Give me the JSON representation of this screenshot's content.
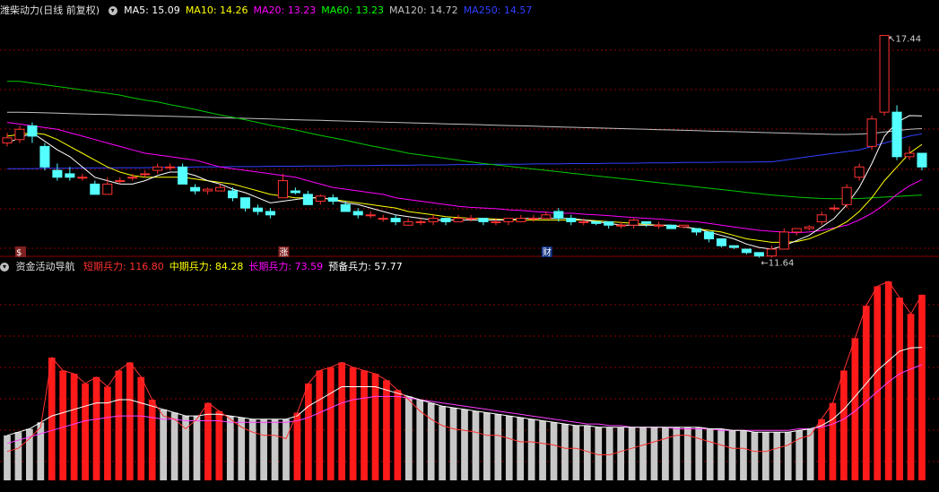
{
  "main_panel": {
    "title": "潍柴动力(日线 前复权)",
    "toggle_icon": "chevron-down-icon",
    "ma": [
      {
        "label": "MA5: 15.09",
        "color": "#ffffff"
      },
      {
        "label": "MA10: 14.26",
        "color": "#ffff00"
      },
      {
        "label": "MA20: 13.23",
        "color": "#ff00ff"
      },
      {
        "label": "MA60: 13.23",
        "color": "#00ff00"
      },
      {
        "label": "MA120: 14.72",
        "color": "#c0c0c0"
      },
      {
        "label": "MA250: 14.57",
        "color": "#3040ff"
      }
    ],
    "high_label": "17.44",
    "low_label": "11.64",
    "markers": [
      {
        "text": "$",
        "index": 1
      },
      {
        "text": "涨",
        "index": 22
      },
      {
        "text": "财",
        "index": 43
      }
    ]
  },
  "indicator_panel": {
    "title": "资金活动导航",
    "toggle_icon": "chevron-down-icon",
    "values": [
      {
        "label": "短期兵力: 116.80",
        "color": "#ff3030"
      },
      {
        "label": "中期兵力: 84.28",
        "color": "#ffff00"
      },
      {
        "label": "长期兵力: 73.59",
        "color": "#ff00ff"
      },
      {
        "label": "预备兵力: 57.77",
        "color": "#ffffff"
      }
    ]
  },
  "colors": {
    "up": "#ff3232",
    "down": "#54ffff",
    "grid": "#8b0000",
    "ma120": "#c0c0c0",
    "ma250": "#3040ff",
    "ma60": "#00c800",
    "bar_red": "#ff1a1a",
    "bar_gray": "#c8c8c8"
  },
  "chart_data": [
    {
      "type": "candlestick",
      "price_range": [
        11.2,
        17.9
      ],
      "candles": [
        [
          14.3,
          14.45,
          14.6,
          14.2
        ],
        [
          14.4,
          14.7,
          14.8,
          14.3
        ],
        [
          14.8,
          14.5,
          14.9,
          14.3
        ],
        [
          14.2,
          13.6,
          14.3,
          13.5
        ],
        [
          13.5,
          13.3,
          13.7,
          13.2
        ],
        [
          13.4,
          13.3,
          13.6,
          13.2
        ],
        [
          13.3,
          13.3,
          13.4,
          13.2
        ],
        [
          13.1,
          12.8,
          13.2,
          12.8
        ],
        [
          12.8,
          13.1,
          13.3,
          12.8
        ],
        [
          13.2,
          13.2,
          13.3,
          13.1
        ],
        [
          13.3,
          13.3,
          13.4,
          13.2
        ],
        [
          13.4,
          13.4,
          13.5,
          13.3
        ],
        [
          13.5,
          13.6,
          13.7,
          13.4
        ],
        [
          13.6,
          13.6,
          13.7,
          13.5
        ],
        [
          13.6,
          13.1,
          13.7,
          13.1
        ],
        [
          13.0,
          12.9,
          13.1,
          12.8
        ],
        [
          12.9,
          12.95,
          13.0,
          12.8
        ],
        [
          12.9,
          13.0,
          13.1,
          12.9
        ],
        [
          12.9,
          12.7,
          13.0,
          12.6
        ],
        [
          12.7,
          12.4,
          12.7,
          12.3
        ],
        [
          12.4,
          12.3,
          12.5,
          12.2
        ],
        [
          12.3,
          12.2,
          12.4,
          12.1
        ],
        [
          12.7,
          13.2,
          13.4,
          12.7
        ],
        [
          12.9,
          12.85,
          13.0,
          12.8
        ],
        [
          12.8,
          12.5,
          12.9,
          12.5
        ],
        [
          12.6,
          12.75,
          12.8,
          12.5
        ],
        [
          12.7,
          12.6,
          12.8,
          12.5
        ],
        [
          12.5,
          12.3,
          12.6,
          12.3
        ],
        [
          12.3,
          12.2,
          12.4,
          12.1
        ],
        [
          12.2,
          12.2,
          12.3,
          12.1
        ],
        [
          12.1,
          12.1,
          12.2,
          12.0
        ],
        [
          12.1,
          12.0,
          12.2,
          11.9
        ],
        [
          11.9,
          12.0,
          12.1,
          11.9
        ],
        [
          12.0,
          12.0,
          12.1,
          11.9
        ],
        [
          12.0,
          12.1,
          12.2,
          11.9
        ],
        [
          12.1,
          12.0,
          12.1,
          11.9
        ],
        [
          12.0,
          12.1,
          12.2,
          12.0
        ],
        [
          12.1,
          12.1,
          12.2,
          12.0
        ],
        [
          12.1,
          12.0,
          12.1,
          11.9
        ],
        [
          12.0,
          12.0,
          12.1,
          11.9
        ],
        [
          12.0,
          12.1,
          12.1,
          11.9
        ],
        [
          12.0,
          12.1,
          12.2,
          12.0
        ],
        [
          12.1,
          12.1,
          12.2,
          12.0
        ],
        [
          12.1,
          12.2,
          12.3,
          12.1
        ],
        [
          12.3,
          12.1,
          12.4,
          12.0
        ],
        [
          12.1,
          12.0,
          12.2,
          11.9
        ],
        [
          12.0,
          12.0,
          12.1,
          11.9
        ],
        [
          12.0,
          11.95,
          12.0,
          11.9
        ],
        [
          12.0,
          11.9,
          12.0,
          11.8
        ],
        [
          11.9,
          11.9,
          12.0,
          11.8
        ],
        [
          11.9,
          12.05,
          12.1,
          11.8
        ],
        [
          12.0,
          11.95,
          12.0,
          11.85
        ],
        [
          11.9,
          11.9,
          12.0,
          11.8
        ],
        [
          11.9,
          11.8,
          11.9,
          11.8
        ],
        [
          11.85,
          11.9,
          11.9,
          11.8
        ],
        [
          11.8,
          11.7,
          11.8,
          11.6
        ],
        [
          11.7,
          11.5,
          11.7,
          11.4
        ],
        [
          11.5,
          11.3,
          11.5,
          11.25
        ],
        [
          11.3,
          11.25,
          11.3,
          11.2
        ],
        [
          11.2,
          11.1,
          11.2,
          11.05
        ],
        [
          11.1,
          11.0,
          11.1,
          10.95
        ],
        [
          11.0,
          11.2,
          11.3,
          10.95
        ],
        [
          11.2,
          11.7,
          11.8,
          11.2
        ],
        [
          11.7,
          11.8,
          11.8,
          11.6
        ],
        [
          11.8,
          11.85,
          11.9,
          11.75
        ],
        [
          12.0,
          12.2,
          12.3,
          11.9
        ],
        [
          12.4,
          12.4,
          12.5,
          12.3
        ],
        [
          12.5,
          13.0,
          13.1,
          12.4
        ],
        [
          13.3,
          13.6,
          13.7,
          13.2
        ],
        [
          14.2,
          15.0,
          15.1,
          14.1
        ],
        [
          15.2,
          17.44,
          17.44,
          15.1
        ],
        [
          15.2,
          13.9,
          15.4,
          13.8
        ],
        [
          13.9,
          14.0,
          14.2,
          13.8
        ],
        [
          14.0,
          13.6,
          14.0,
          13.5
        ]
      ],
      "ma5": [
        14.3,
        14.45,
        14.6,
        14.35,
        14.1,
        13.9,
        13.6,
        13.3,
        13.2,
        13.1,
        13.1,
        13.2,
        13.35,
        13.45,
        13.45,
        13.35,
        13.2,
        13.1,
        12.95,
        12.85,
        12.7,
        12.55,
        12.6,
        12.65,
        12.7,
        12.7,
        12.65,
        12.55,
        12.5,
        12.4,
        12.3,
        12.2,
        12.15,
        12.1,
        12.05,
        12.05,
        12.05,
        12.05,
        12.05,
        12.05,
        12.05,
        12.1,
        12.1,
        12.1,
        12.1,
        12.1,
        12.05,
        12.0,
        11.95,
        11.9,
        11.9,
        11.9,
        11.9,
        11.9,
        11.85,
        11.8,
        11.7,
        11.6,
        11.5,
        11.35,
        11.25,
        11.2,
        11.3,
        11.45,
        11.6,
        11.85,
        12.1,
        12.5,
        13.0,
        13.7,
        14.5,
        14.9,
        15.1,
        15.09
      ],
      "ma10": [
        14.5,
        14.55,
        14.6,
        14.55,
        14.4,
        14.2,
        14.0,
        13.8,
        13.6,
        13.45,
        13.35,
        13.3,
        13.3,
        13.3,
        13.3,
        13.25,
        13.2,
        13.15,
        13.1,
        13.0,
        12.9,
        12.8,
        12.75,
        12.7,
        12.7,
        12.7,
        12.65,
        12.6,
        12.55,
        12.5,
        12.45,
        12.4,
        12.3,
        12.25,
        12.2,
        12.15,
        12.12,
        12.1,
        12.1,
        12.08,
        12.05,
        12.05,
        12.05,
        12.05,
        12.05,
        12.05,
        12.05,
        12.03,
        12.0,
        11.98,
        11.95,
        11.92,
        11.9,
        11.88,
        11.85,
        11.8,
        11.75,
        11.7,
        11.6,
        11.5,
        11.45,
        11.4,
        11.4,
        11.42,
        11.5,
        11.65,
        11.8,
        12.0,
        12.3,
        12.7,
        13.2,
        13.6,
        14.0,
        14.26
      ],
      "ma20": [
        14.9,
        14.85,
        14.8,
        14.75,
        14.7,
        14.6,
        14.5,
        14.4,
        14.3,
        14.2,
        14.1,
        14.0,
        13.95,
        13.9,
        13.85,
        13.8,
        13.7,
        13.6,
        13.55,
        13.5,
        13.45,
        13.4,
        13.35,
        13.3,
        13.2,
        13.1,
        13.0,
        12.95,
        12.9,
        12.85,
        12.8,
        12.7,
        12.65,
        12.6,
        12.55,
        12.5,
        12.45,
        12.42,
        12.4,
        12.38,
        12.35,
        12.33,
        12.3,
        12.28,
        12.25,
        12.25,
        12.22,
        12.2,
        12.18,
        12.15,
        12.12,
        12.1,
        12.08,
        12.05,
        12.02,
        12.0,
        11.95,
        11.9,
        11.85,
        11.8,
        11.75,
        11.72,
        11.7,
        11.68,
        11.7,
        11.75,
        11.82,
        11.9,
        12.05,
        12.25,
        12.5,
        12.8,
        13.05,
        13.23
      ],
      "ma60": [
        16.1,
        16.1,
        16.05,
        16.0,
        15.95,
        15.9,
        15.85,
        15.8,
        15.75,
        15.7,
        15.62,
        15.55,
        15.5,
        15.42,
        15.35,
        15.28,
        15.2,
        15.12,
        15.05,
        14.98,
        14.9,
        14.82,
        14.75,
        14.68,
        14.6,
        14.52,
        14.45,
        14.38,
        14.3,
        14.22,
        14.15,
        14.08,
        14.0,
        13.95,
        13.9,
        13.85,
        13.8,
        13.75,
        13.7,
        13.66,
        13.62,
        13.58,
        13.54,
        13.5,
        13.46,
        13.42,
        13.38,
        13.34,
        13.3,
        13.26,
        13.22,
        13.18,
        13.14,
        13.1,
        13.06,
        13.02,
        12.98,
        12.94,
        12.9,
        12.86,
        12.82,
        12.78,
        12.75,
        12.72,
        12.7,
        12.68,
        12.67,
        12.67,
        12.68,
        12.7,
        12.72,
        12.74,
        12.76,
        12.78
      ],
      "ma120": [
        15.2,
        15.2,
        15.19,
        15.18,
        15.17,
        15.16,
        15.15,
        15.14,
        15.13,
        15.12,
        15.11,
        15.1,
        15.09,
        15.08,
        15.07,
        15.06,
        15.05,
        15.04,
        15.03,
        15.02,
        15.01,
        15.0,
        14.99,
        14.98,
        14.97,
        14.96,
        14.95,
        14.94,
        14.93,
        14.92,
        14.91,
        14.9,
        14.89,
        14.88,
        14.87,
        14.86,
        14.85,
        14.84,
        14.83,
        14.82,
        14.81,
        14.8,
        14.79,
        14.78,
        14.77,
        14.76,
        14.75,
        14.74,
        14.73,
        14.72,
        14.71,
        14.7,
        14.69,
        14.68,
        14.67,
        14.66,
        14.65,
        14.64,
        14.63,
        14.62,
        14.61,
        14.6,
        14.59,
        14.58,
        14.57,
        14.56,
        14.55,
        14.55,
        14.56,
        14.58,
        14.62,
        14.66,
        14.7,
        14.72
      ],
      "ma250": [
        13.55,
        13.55,
        13.55,
        13.56,
        13.56,
        13.56,
        13.57,
        13.57,
        13.57,
        13.58,
        13.58,
        13.58,
        13.59,
        13.59,
        13.59,
        13.6,
        13.6,
        13.6,
        13.61,
        13.61,
        13.61,
        13.62,
        13.62,
        13.62,
        13.63,
        13.63,
        13.63,
        13.64,
        13.64,
        13.64,
        13.65,
        13.65,
        13.65,
        13.66,
        13.66,
        13.66,
        13.67,
        13.67,
        13.67,
        13.68,
        13.68,
        13.68,
        13.69,
        13.69,
        13.69,
        13.7,
        13.7,
        13.7,
        13.71,
        13.71,
        13.71,
        13.72,
        13.72,
        13.72,
        13.73,
        13.73,
        13.73,
        13.74,
        13.74,
        13.74,
        13.75,
        13.75,
        13.8,
        13.85,
        13.9,
        13.95,
        14.0,
        14.05,
        14.1,
        14.2,
        14.3,
        14.4,
        14.5,
        14.57
      ]
    },
    {
      "type": "bar",
      "value_range": [
        0,
        130
      ],
      "short_force": [
        20,
        22,
        28,
        35,
        78,
        70,
        68,
        62,
        66,
        60,
        70,
        75,
        66,
        52,
        42,
        40,
        34,
        40,
        50,
        45,
        40,
        35,
        32,
        30,
        30,
        28,
        44,
        62,
        70,
        72,
        75,
        72,
        70,
        68,
        64,
        58,
        52,
        45,
        40,
        36,
        34,
        33,
        32,
        30,
        30,
        28,
        26,
        26,
        25,
        24,
        22,
        22,
        20,
        18,
        18,
        20,
        22,
        24,
        26,
        28,
        30,
        30,
        28,
        26,
        24,
        22,
        22,
        20,
        20,
        22,
        24,
        28,
        30,
        40,
        50,
        70,
        90,
        110,
        122,
        125,
        115,
        105,
        116.8
      ],
      "mid_force": [
        30,
        32,
        34,
        38,
        42,
        44,
        46,
        48,
        50,
        50,
        52,
        52,
        50,
        48,
        46,
        44,
        42,
        42,
        43,
        43,
        42,
        41,
        40,
        40,
        40,
        40,
        42,
        48,
        52,
        56,
        60,
        60,
        60,
        60,
        58,
        56,
        54,
        52,
        50,
        48,
        47,
        46,
        45,
        44,
        43,
        42,
        41,
        40,
        39,
        38,
        37,
        36,
        36,
        35,
        35,
        35,
        35,
        35,
        35,
        35,
        35,
        35,
        35,
        34,
        34,
        33,
        33,
        32,
        32,
        32,
        32,
        33,
        34,
        36,
        40,
        46,
        54,
        62,
        70,
        76,
        82,
        84,
        84.28
      ],
      "long_force": [
        25,
        27,
        29,
        31,
        33,
        35,
        37,
        39,
        40,
        41,
        42,
        42,
        42,
        41,
        40,
        40,
        39,
        39,
        39,
        39,
        38,
        38,
        38,
        38,
        38,
        38,
        39,
        41,
        44,
        47,
        50,
        52,
        53,
        54,
        54,
        54,
        53,
        52,
        51,
        50,
        49,
        48,
        47,
        46,
        45,
        44,
        43,
        42,
        41,
        40,
        39,
        38,
        37,
        37,
        36,
        36,
        35,
        35,
        35,
        35,
        34,
        34,
        34,
        34,
        33,
        33,
        33,
        33,
        33,
        33,
        33,
        34,
        34,
        35,
        37,
        40,
        45,
        51,
        57,
        63,
        68,
        71,
        73.59
      ]
    }
  ]
}
